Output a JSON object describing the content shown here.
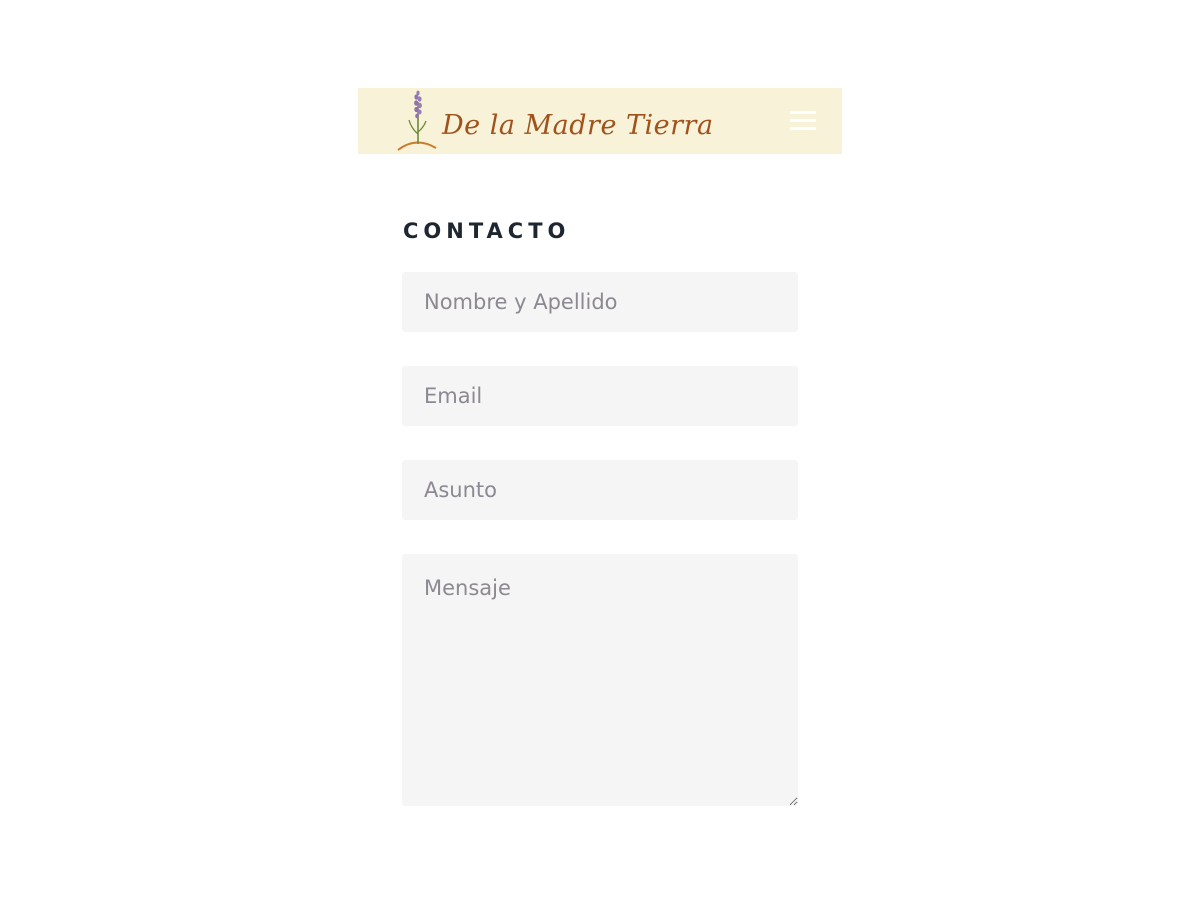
{
  "header": {
    "logo_text": "De la Madre Tierra",
    "logo_icon": "lavender-icon",
    "menu_icon": "hamburger-menu-icon",
    "background_color": "#f8f2d8"
  },
  "contact": {
    "title": "CONTACTO",
    "fields": {
      "name_placeholder": "Nombre y Apellido",
      "email_placeholder": "Email",
      "subject_placeholder": "Asunto",
      "message_placeholder": "Mensaje"
    }
  },
  "colors": {
    "title": "#1e2730",
    "logo_text": "#a0521c",
    "field_background": "#f5f5f5",
    "placeholder": "#8d8891"
  }
}
